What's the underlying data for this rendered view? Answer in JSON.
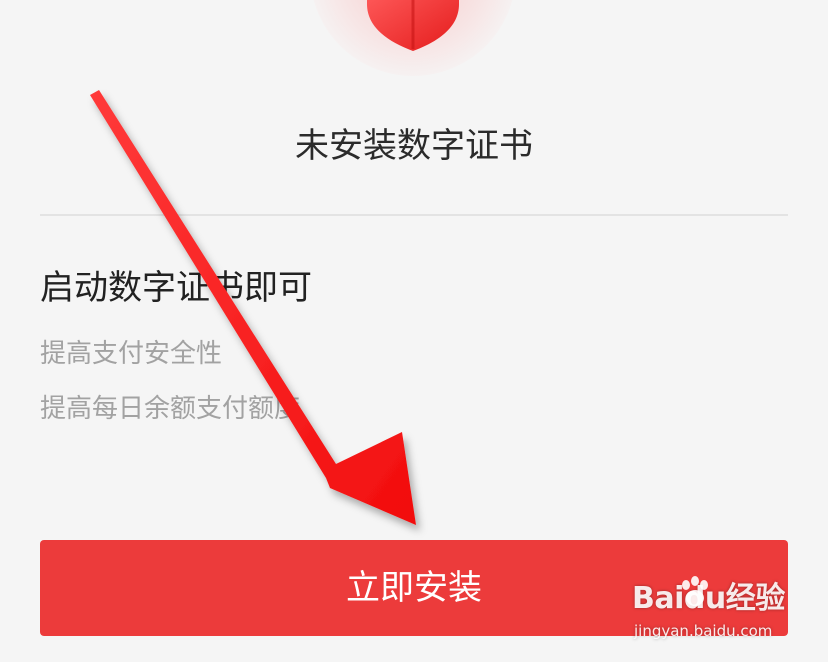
{
  "header": {
    "icon": "shield-icon",
    "status_title": "未安装数字证书"
  },
  "benefits": {
    "heading": "启动数字证书即可",
    "items": [
      "提高支付安全性",
      "提高每日余额支付额度"
    ]
  },
  "actions": {
    "install_label": "立即安装"
  },
  "watermark": {
    "logo_text": "Baidu经验",
    "url": "jingyan.baidu.com"
  },
  "colors": {
    "accent": "#ec3b3b",
    "background": "#f5f5f5",
    "arrow": "#ff1a1a"
  }
}
